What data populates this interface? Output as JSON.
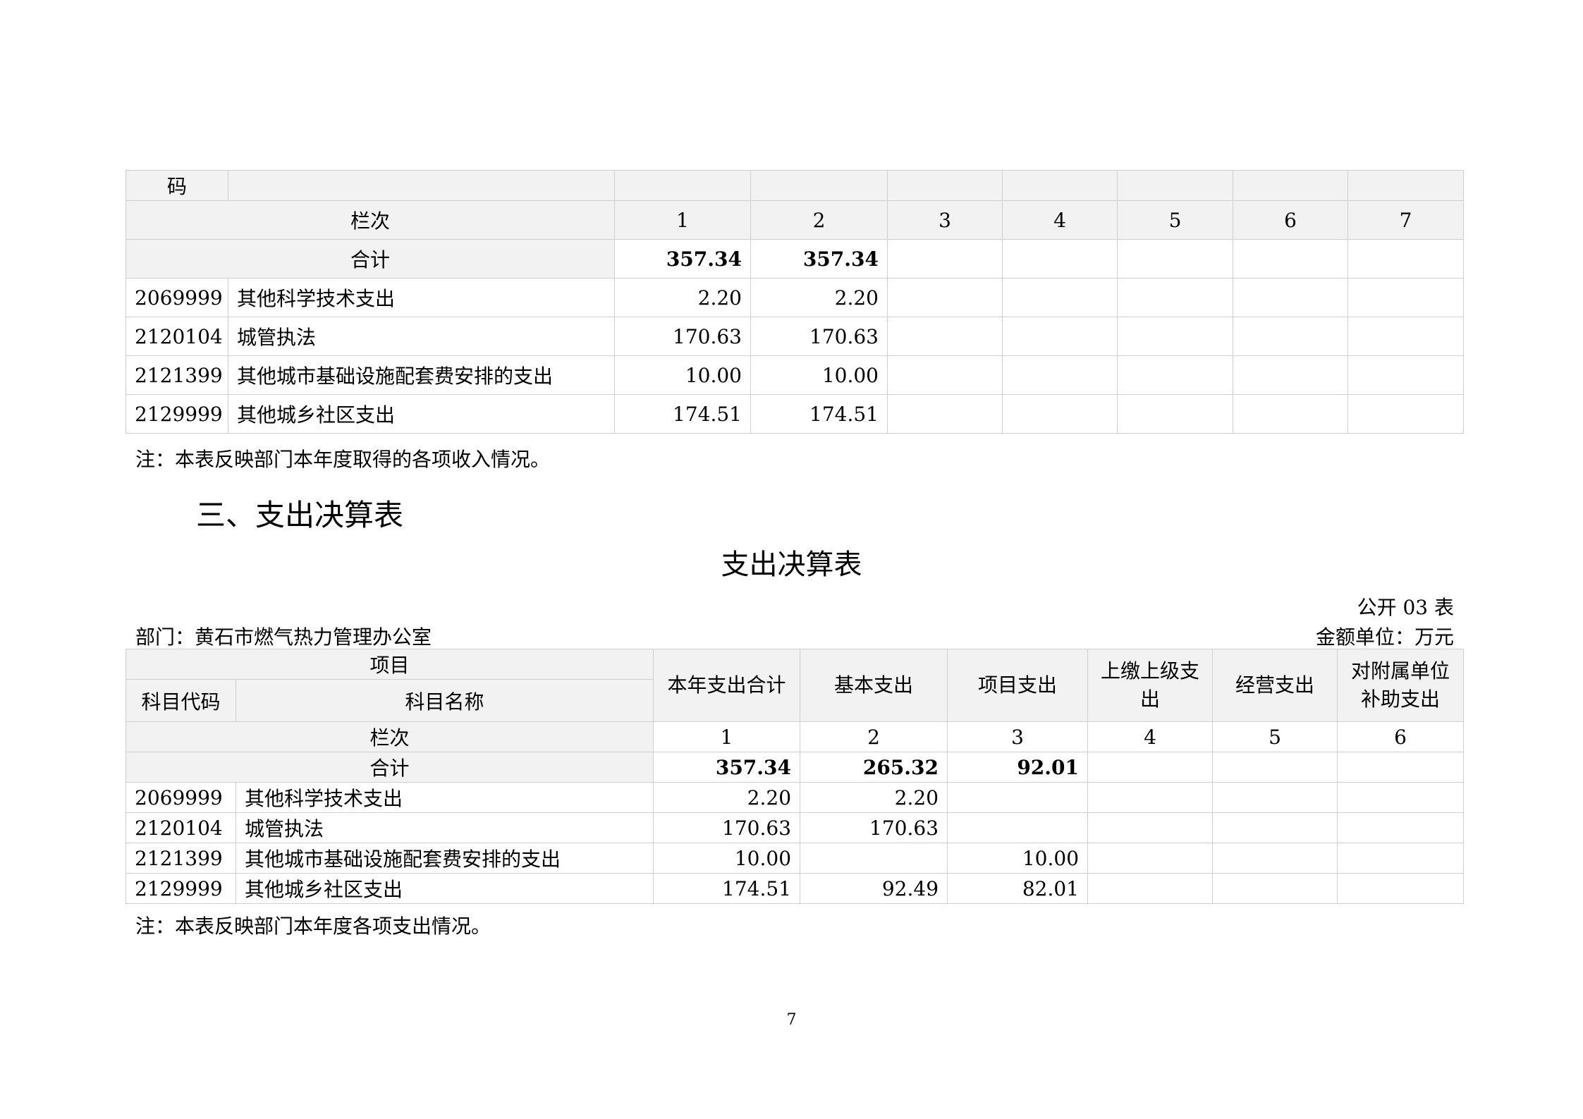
{
  "table1": {
    "header_fragment": "码",
    "rank_row": {
      "label": "栏次",
      "cols": [
        "1",
        "2",
        "3",
        "4",
        "5",
        "6",
        "7"
      ]
    },
    "total_row": {
      "label": "合计",
      "values": [
        "357.34",
        "357.34",
        "",
        "",
        "",
        "",
        ""
      ]
    },
    "rows": [
      {
        "code": "2069999",
        "name": "其他科学技术支出",
        "values": [
          "2.20",
          "2.20",
          "",
          "",
          "",
          "",
          ""
        ]
      },
      {
        "code": "2120104",
        "name": "城管执法",
        "values": [
          "170.63",
          "170.63",
          "",
          "",
          "",
          "",
          ""
        ]
      },
      {
        "code": "2121399",
        "name": "其他城市基础设施配套费安排的支出",
        "values": [
          "10.00",
          "10.00",
          "",
          "",
          "",
          "",
          ""
        ]
      },
      {
        "code": "2129999",
        "name": "其他城乡社区支出",
        "values": [
          "174.51",
          "174.51",
          "",
          "",
          "",
          "",
          ""
        ]
      }
    ],
    "note": "注：本表反映部门本年度取得的各项收入情况。"
  },
  "section_heading": "三、支出决算表",
  "table2": {
    "title": "支出决算表",
    "table_code": "公开 03 表",
    "department": "部门：黄石市燃气热力管理办公室",
    "unit": "金额单位：万元",
    "headers": {
      "item": "项目",
      "code": "科目代码",
      "name": "科目名称",
      "cols": [
        "本年支出合计",
        "基本支出",
        "项目支出",
        "上缴上级支出",
        "经营支出",
        "对附属单位补助支出"
      ]
    },
    "rank_row": {
      "label": "栏次",
      "cols": [
        "1",
        "2",
        "3",
        "4",
        "5",
        "6"
      ]
    },
    "total_row": {
      "label": "合计",
      "values": [
        "357.34",
        "265.32",
        "92.01",
        "",
        "",
        ""
      ]
    },
    "rows": [
      {
        "code": "2069999",
        "name": "其他科学技术支出",
        "values": [
          "2.20",
          "2.20",
          "",
          "",
          "",
          ""
        ]
      },
      {
        "code": "2120104",
        "name": "城管执法",
        "values": [
          "170.63",
          "170.63",
          "",
          "",
          "",
          ""
        ]
      },
      {
        "code": "2121399",
        "name": "其他城市基础设施配套费安排的支出",
        "values": [
          "10.00",
          "",
          "10.00",
          "",
          "",
          ""
        ]
      },
      {
        "code": "2129999",
        "name": "其他城乡社区支出",
        "values": [
          "174.51",
          "92.49",
          "82.01",
          "",
          "",
          ""
        ]
      }
    ],
    "note": "注：本表反映部门本年度各项支出情况。"
  },
  "page_number": "7"
}
